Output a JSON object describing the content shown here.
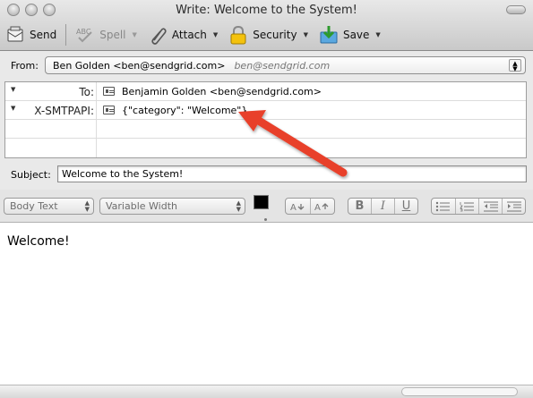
{
  "window": {
    "title": "Write: Welcome to the System!"
  },
  "toolbar": {
    "send": "Send",
    "spell": "Spell",
    "attach": "Attach",
    "security": "Security",
    "save": "Save",
    "spell_icon_text": "ABC"
  },
  "header": {
    "from_label": "From:",
    "from_value": "Ben Golden <ben@sendgrid.com>",
    "from_alias": "ben@sendgrid.com",
    "rows": [
      {
        "label": "To:",
        "value": "Benjamin Golden <ben@sendgrid.com>"
      },
      {
        "label": "X-SMTPAPI:",
        "value": "{\"category\": \"Welcome\"}"
      }
    ],
    "subject_label": "Subject:",
    "subject_value": "Welcome to the System!"
  },
  "format": {
    "paragraph_style": "Body Text",
    "font": "Variable Width",
    "bold": "B",
    "italic": "I",
    "underline": "U",
    "text_color": "#000000",
    "background_color": "#ffffff"
  },
  "body": {
    "text": "Welcome!"
  },
  "annotation": {
    "arrow_color": "#e8402a"
  },
  "icons": {
    "send": "envelope-send-icon",
    "spell": "spellcheck-icon",
    "attach": "paperclip-icon",
    "security": "padlock-icon",
    "save": "save-disk-icon"
  }
}
